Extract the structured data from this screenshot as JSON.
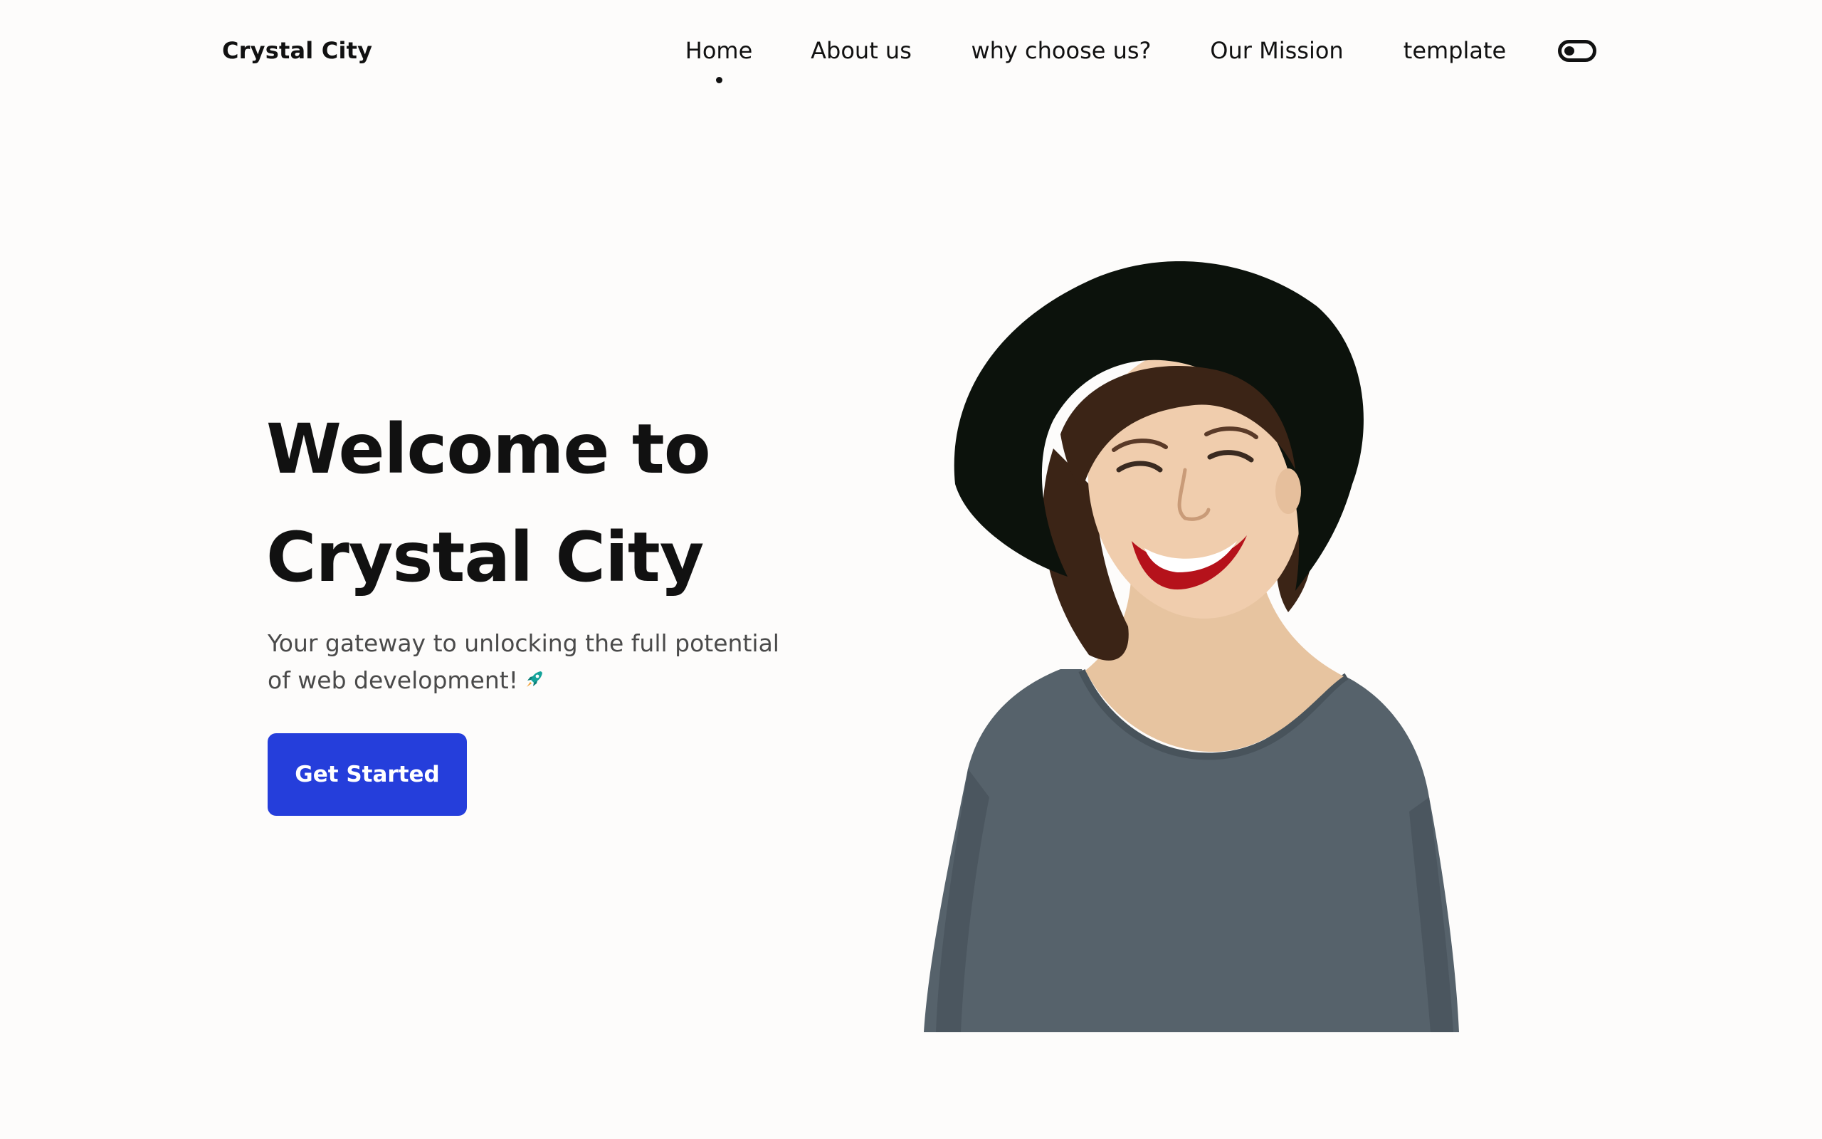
{
  "header": {
    "logo": "Crystal City",
    "nav": [
      {
        "label": "Home",
        "active": true
      },
      {
        "label": "About us"
      },
      {
        "label": "why choose us?"
      },
      {
        "label": "Our Mission"
      },
      {
        "label": "template"
      }
    ],
    "theme_toggle": {
      "icon": "toggle-icon",
      "state": "off"
    }
  },
  "hero": {
    "title_line1": "Welcome to",
    "title_line2": "Crystal City",
    "subtitle": "Your gateway to unlocking the full potential of web development!",
    "subtitle_icon": "rocket-icon",
    "cta_label": "Get Started",
    "image": "smiling-woman-in-hat-portrait"
  },
  "colors": {
    "background": "#fdfcfb",
    "text": "#111111",
    "muted_text": "#4a4a4a",
    "accent": "#253edb"
  }
}
